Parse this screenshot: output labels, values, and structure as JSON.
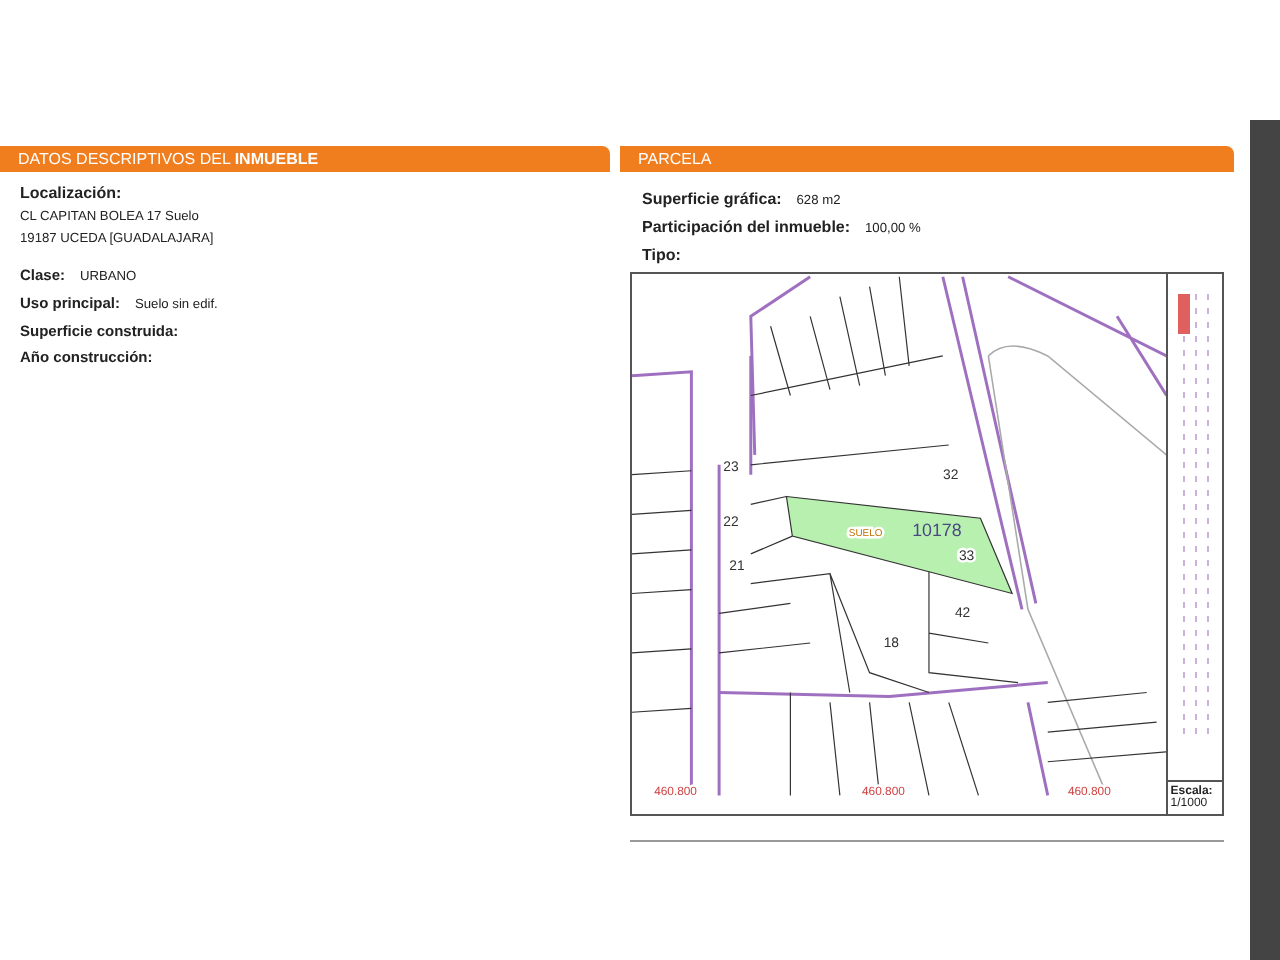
{
  "left_panel": {
    "title_prefix": "DATOS DESCRIPTIVOS DEL ",
    "title_emphasis": "INMUEBLE",
    "location_label": "Localización:",
    "address_lines": [
      "CL CAPITAN BOLEA 17 Suelo",
      "19187 UCEDA [GUADALAJARA]"
    ],
    "fields": [
      {
        "label": "Clase:",
        "value": "URBANO"
      },
      {
        "label": "Uso principal:",
        "value": "Suelo sin edif."
      },
      {
        "label": "Superficie construida:"
      },
      {
        "label": "Año construcción:"
      }
    ]
  },
  "right_panel": {
    "title": "PARCELA",
    "fields": [
      {
        "label": "Superficie gráfica:",
        "value": "628 m2"
      },
      {
        "label": "Participación del inmueble:",
        "value": "100,00 %"
      },
      {
        "label": "Tipo:"
      }
    ],
    "map": {
      "labels": [
        {
          "text": "32",
          "kind": "number"
        },
        {
          "text": "10178",
          "kind": "cadastral"
        },
        {
          "text": "33",
          "kind": "number"
        },
        {
          "text": "SUELO",
          "kind": "use"
        },
        {
          "text": "42",
          "kind": "number"
        },
        {
          "text": "18",
          "kind": "number"
        },
        {
          "text": "23",
          "kind": "number"
        },
        {
          "text": "22",
          "kind": "number"
        },
        {
          "text": "21",
          "kind": "number"
        },
        {
          "text": "460.800",
          "kind": "coordinate"
        },
        {
          "text": "460.800",
          "kind": "coordinate"
        },
        {
          "text": "460.800",
          "kind": "coordinate"
        }
      ],
      "scale_label": "Escala:",
      "scale_value": "1/1000"
    }
  }
}
